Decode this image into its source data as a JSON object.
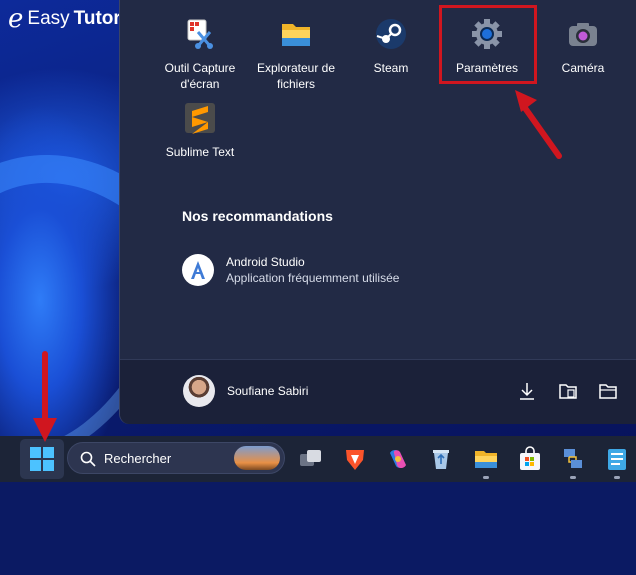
{
  "watermark": {
    "prefix": "Easy",
    "suffix": "Tutoriel"
  },
  "pinned_apps": [
    {
      "label": "Outil Capture d'écran",
      "icon": "snipping-tool-icon"
    },
    {
      "label": "Explorateur de fichiers",
      "icon": "folder-icon"
    },
    {
      "label": "Steam",
      "icon": "steam-icon"
    },
    {
      "label": "Paramètres",
      "icon": "gear-icon"
    },
    {
      "label": "Caméra",
      "icon": "camera-icon"
    },
    {
      "label": "Sublime Text",
      "icon": "sublime-icon"
    }
  ],
  "recommendations": {
    "title": "Nos recommandations",
    "items": [
      {
        "name": "Android Studio",
        "subtitle": "Application fréquemment utilisée",
        "icon": "android-studio-icon"
      }
    ]
  },
  "user": {
    "name": "Soufiane Sabiri"
  },
  "user_bar_icons": [
    "download-icon",
    "documents-folder-icon",
    "folder-icon"
  ],
  "taskbar": {
    "search_placeholder": "Rechercher",
    "icons": [
      "task-view-icon",
      "brave-icon",
      "copilot-icon",
      "recycle-bin-icon",
      "file-explorer-icon",
      "microsoft-store-icon",
      "network-icon",
      "notepad-icon"
    ]
  },
  "colors": {
    "highlight": "#d0161f",
    "menu_bg": "#222a45",
    "taskbar_bg": "#1c2437"
  }
}
